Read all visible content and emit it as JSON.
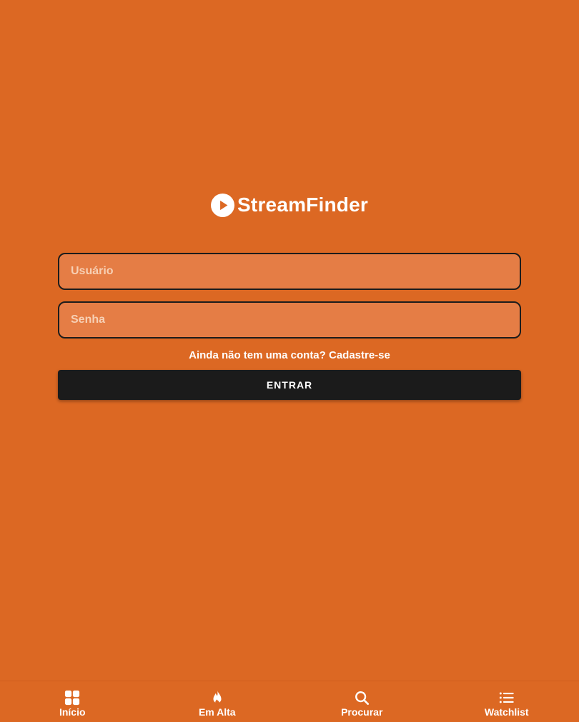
{
  "brand": {
    "name": "StreamFinder",
    "icon": "play-circle-icon"
  },
  "login": {
    "username_placeholder": "Usuário",
    "username_value": "",
    "password_placeholder": "Senha",
    "password_value": "",
    "signup_text": "Ainda não tem uma conta? Cadastre-se",
    "submit_label": "ENTRAR"
  },
  "nav": {
    "items": [
      {
        "label": "Início",
        "icon": "grid-icon"
      },
      {
        "label": "Em Alta",
        "icon": "fire-icon"
      },
      {
        "label": "Procurar",
        "icon": "search-icon"
      },
      {
        "label": "Watchlist",
        "icon": "list-icon"
      }
    ]
  },
  "colors": {
    "background": "#dc6823",
    "input_background": "#e57d45",
    "button": "#1b1b1b",
    "text": "#ffffff"
  }
}
